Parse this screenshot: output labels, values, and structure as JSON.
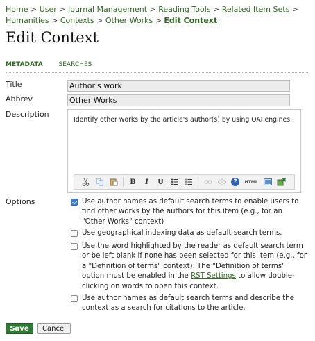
{
  "breadcrumb": [
    {
      "label": "Home",
      "current": false
    },
    {
      "label": "User",
      "current": false
    },
    {
      "label": "Journal Management",
      "current": false
    },
    {
      "label": "Reading Tools",
      "current": false
    },
    {
      "label": "Related Item Sets",
      "current": false
    },
    {
      "label": "Humanities",
      "current": false
    },
    {
      "label": "Contexts",
      "current": false
    },
    {
      "label": "Other Works",
      "current": false
    },
    {
      "label": "Edit Context",
      "current": true
    }
  ],
  "breadcrumb_separator": ">",
  "page_title": "Edit Context",
  "tabs": {
    "metadata": "Metadata",
    "searches": "Searches"
  },
  "form": {
    "title_label": "Title",
    "title_value": "Author's work",
    "abbrev_label": "Abbrev",
    "abbrev_value": "Other Works",
    "description_label": "Description",
    "description_value": "Identify other works by the article's author(s) by using OAI engines.",
    "toolbar_icons": [
      "cut-icon",
      "copy-icon",
      "paste-icon",
      "bold-icon",
      "italic-icon",
      "underline-icon",
      "bullet-list-icon",
      "numbered-list-icon",
      "link-icon",
      "unlink-icon",
      "help-icon",
      "html-icon",
      "image-icon",
      "insert-icon"
    ],
    "toolbar_text": {
      "bold": "B",
      "italic": "I",
      "underline": "U",
      "help": "?",
      "html": "HTML"
    },
    "options_label": "Options",
    "options": [
      {
        "checked": true,
        "text": "Use author names as default search terms to enable users to find other works by the authors for this item (e.g., for an \"Other Works\" context)"
      },
      {
        "checked": false,
        "text": "Use geographical indexing data as default search terms."
      },
      {
        "checked": false,
        "text_before": "Use the word highlighted by the reader as default search term or be left blank if none has been selected for this item (e.g., for a \"Definition of terms\" context). The \"Definition of terms\" option must be enabled in the",
        "link": "RST Settings",
        "text_after": "to allow double-clicking on words to open this context."
      },
      {
        "checked": false,
        "text": "Use author names as default search terms and describe the context as a search for citations to the article."
      }
    ]
  },
  "buttons": {
    "save": "Save",
    "cancel": "Cancel"
  },
  "colors": {
    "accent": "#2a6b1c",
    "save_button": "#2f7a35",
    "checkbox_checked": "#3b82d6"
  }
}
